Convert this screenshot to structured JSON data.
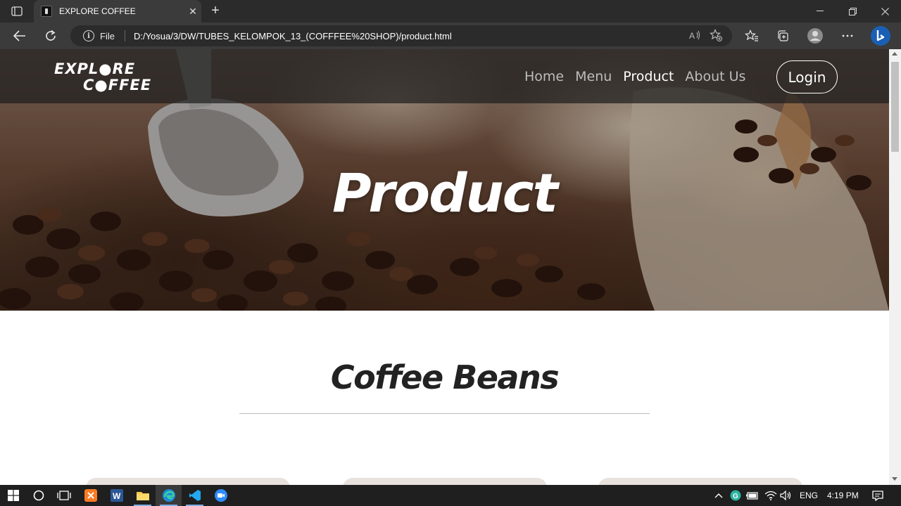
{
  "browser": {
    "tab_title": "EXPLORE COFFEE",
    "tab_close": "✕",
    "new_tab": "+",
    "address_scheme": "File",
    "url": "D:/Yosua/3/DW/TUBES_KELOMPOK_13_(COFFFEE%20SHOP)/product.html",
    "icons": [
      "tab-actions-icon",
      "back-icon",
      "refresh-icon",
      "info-icon",
      "read-aloud-icon",
      "add-favorite-icon",
      "favorites-icon",
      "collections-icon",
      "profile-icon",
      "more-icon",
      "bing-icon"
    ]
  },
  "site": {
    "logo_line1": "EXPL●RE",
    "logo_line2": "C●FFEE",
    "nav": [
      {
        "label": "Home",
        "active": false
      },
      {
        "label": "Menu",
        "active": false
      },
      {
        "label": "Product",
        "active": true
      },
      {
        "label": "About Us",
        "active": false
      }
    ],
    "login_label": "Login",
    "hero_title": "Product",
    "section_title": "Coffee Beans"
  },
  "taskbar": {
    "language": "ENG",
    "time": "4:19 PM",
    "pinned": [
      "start-icon",
      "search-icon",
      "task-view-icon",
      "xampp-icon",
      "word-icon",
      "file-explorer-icon",
      "edge-icon",
      "vscode-icon",
      "zoom-icon"
    ]
  },
  "colors": {
    "chrome_dark": "#2b2b2b",
    "chrome_toolbar": "#3b3b3b",
    "nav_inactive": "#bdbdbd",
    "heading_text": "#222222"
  }
}
